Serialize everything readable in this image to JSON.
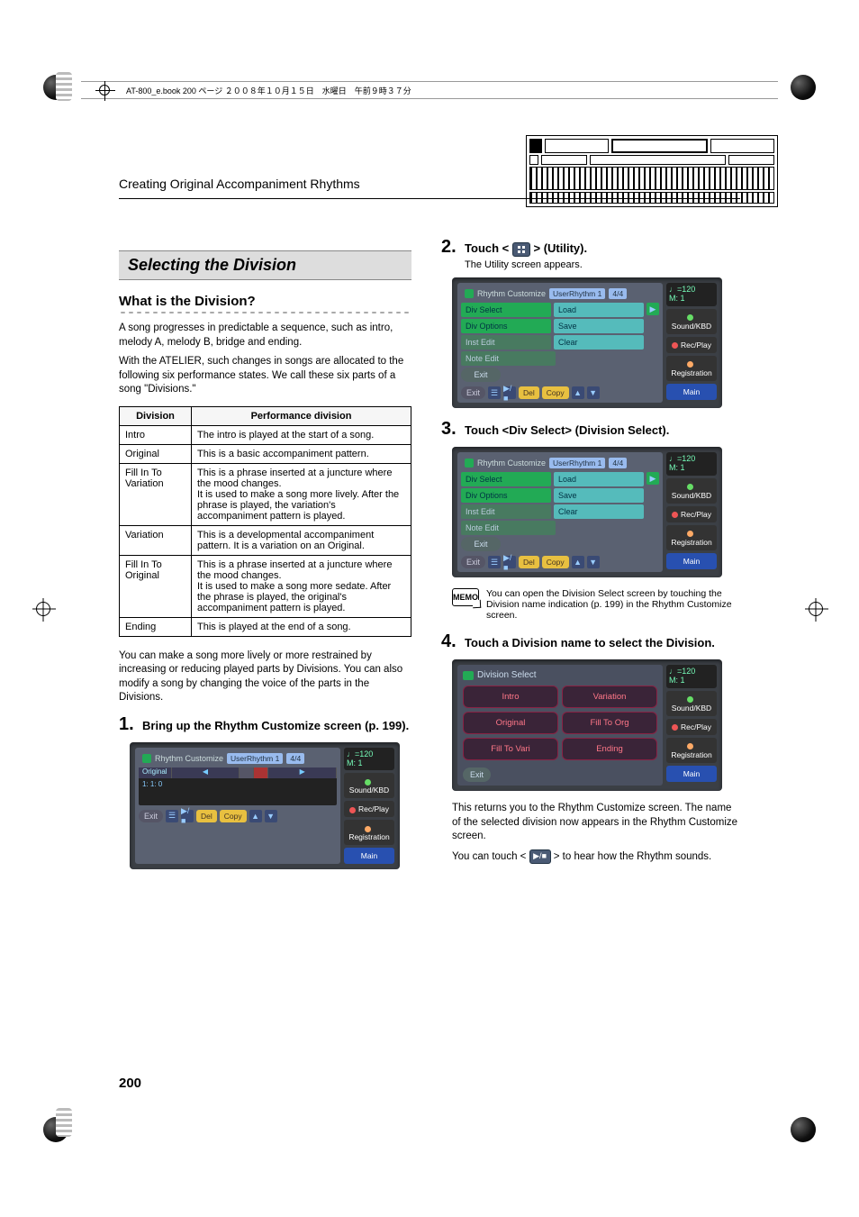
{
  "bookHeader": "AT-800_e.book  200 ページ  ２００８年１０月１５日　水曜日　午前９時３７分",
  "chapterTitle": "Creating Original Accompaniment Rhythms",
  "pageNumber": "200",
  "sectionBar": "Selecting the Division",
  "subHeading": "What is the Division?",
  "intro1": "A song progresses in predictable a sequence, such as intro, melody A, melody B, bridge and ending.",
  "intro2": "With the ATELIER, such changes in songs are allocated to the following six performance states. We call these six parts of a song \"Divisions.\"",
  "table": {
    "headers": [
      "Division",
      "Performance division"
    ],
    "rows": [
      [
        "Intro",
        "The intro is played at the start of a song."
      ],
      [
        "Original",
        "This is a basic accompaniment pattern."
      ],
      [
        "Fill In To Variation",
        "This is a phrase inserted at a juncture where the mood changes.\nIt is used to make a song more lively. After the phrase is played, the variation's accompaniment pattern is played."
      ],
      [
        "Variation",
        "This is a developmental accompaniment pattern. It is a variation on an Original."
      ],
      [
        "Fill In To Original",
        "This is a phrase inserted at a juncture where the mood changes.\nIt is used to make a song more sedate. After the phrase is played, the original's accompaniment pattern is played."
      ],
      [
        "Ending",
        "This is played at the end of a song."
      ]
    ]
  },
  "afterTable": "You can make a song more lively or more restrained by increasing or reducing played parts by Divisions. You can also modify a song by changing the voice of the parts in the Divisions.",
  "steps": {
    "s1": {
      "num": "1.",
      "text": "Bring up the Rhythm Customize screen (p. 199)."
    },
    "s2": {
      "num": "2.",
      "text_before": "Touch < ",
      "text_after": " > (Utility).",
      "sub": "The Utility screen appears."
    },
    "s3": {
      "num": "3.",
      "text": "Touch <Div Select> (Division Select)."
    },
    "s4": {
      "num": "4.",
      "text": "Touch a Division name to select the Division."
    }
  },
  "memoText": "You can open the Division Select screen by touching the Division name indication (p. 199) in the Rhythm Customize screen.",
  "afterStep4a": "This returns you to the Rhythm Customize screen. The name of the selected division now appears in the Rhythm Customize screen.",
  "afterStep4b_before": "You can touch < ",
  "afterStep4b_after": " > to hear how the Rhythm sounds.",
  "scr": {
    "rhythmCustomize": {
      "title": "Rhythm Customize",
      "box1": "UserRhythm 1",
      "box2": "4/4",
      "trackHead": [
        "Original",
        "◀",
        "▶"
      ],
      "pos": "1: 1: 0",
      "exit": "Exit",
      "del": "Del",
      "copy": "Copy"
    },
    "menu": {
      "title": "Rhythm Customize",
      "box1": "UserRhythm 1",
      "box2": "4/4",
      "leftItems": [
        "Div Select",
        "Div Options",
        "Inst Edit",
        "Note Edit"
      ],
      "rightItems": [
        "Load",
        "Save",
        "Clear"
      ],
      "exit": "Exit",
      "del": "Del",
      "copy": "Copy"
    },
    "divSelect": {
      "title": "Division Select",
      "cells": [
        "Intro",
        "Variation",
        "Original",
        "Fill To Org",
        "Fill To Vari",
        "Ending"
      ],
      "exit": "Exit"
    },
    "side": {
      "tempo": "♩=120",
      "measure": "M:    1",
      "sound": "Sound/KBD",
      "rec": "Rec/Play",
      "reg": "Registration",
      "main": "Main"
    }
  }
}
